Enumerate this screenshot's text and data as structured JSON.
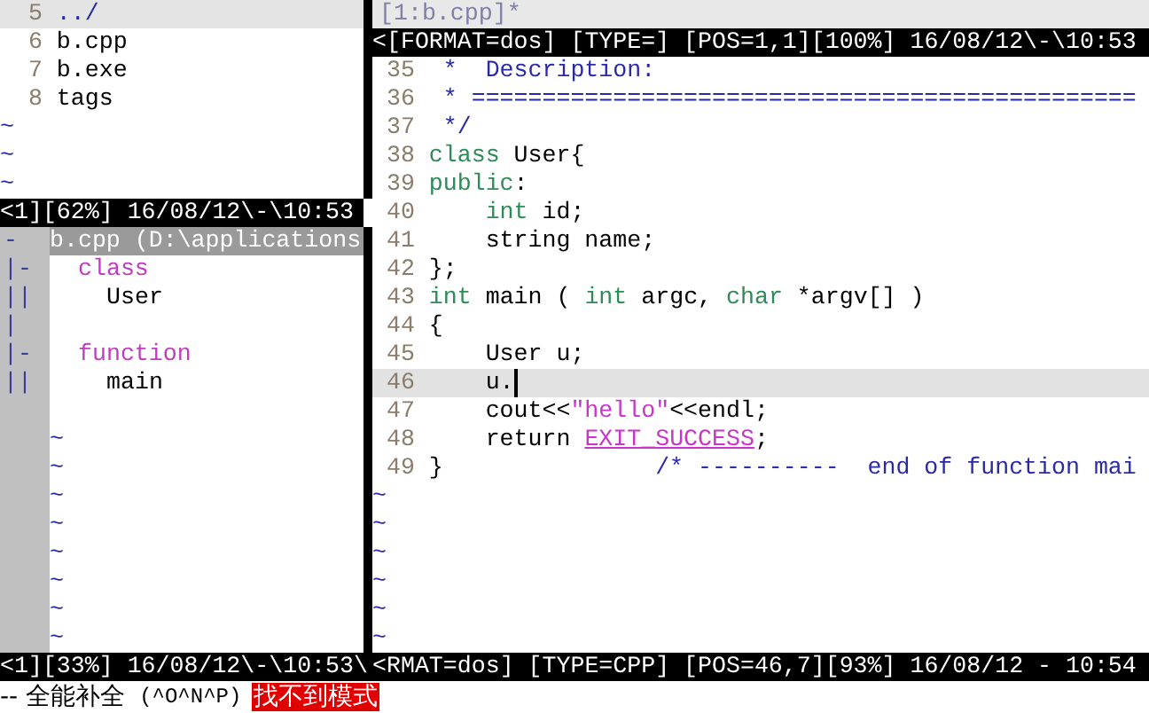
{
  "file_tree": {
    "lines": [
      {
        "number": "5",
        "name": "../",
        "selected": true
      },
      {
        "number": "6",
        "name": "b.cpp",
        "selected": false
      },
      {
        "number": "7",
        "name": "b.exe",
        "selected": false
      },
      {
        "number": "8",
        "name": "tags",
        "selected": false
      }
    ],
    "filler_lines": [
      "~",
      "~",
      "~"
    ],
    "status": "<1][62%] 16/08/12\\-\\10:53"
  },
  "taglist": {
    "header": {
      "fold": "-",
      "text": "b.cpp (D:\\applications"
    },
    "rows": [
      {
        "kind": "group",
        "fold": "|-",
        "text": "class"
      },
      {
        "kind": "tag",
        "fold": "||",
        "text": "User"
      },
      {
        "kind": "blank",
        "fold": "|"
      },
      {
        "kind": "group",
        "fold": "|-",
        "text": "function"
      },
      {
        "kind": "tag",
        "fold": "||",
        "text": "main"
      },
      {
        "kind": "blank"
      }
    ],
    "filler_lines": [
      "~",
      "~",
      "~",
      "~",
      "~",
      "~",
      "~",
      "~"
    ],
    "status": "<1][33%] 16/08/12\\-\\10:53\\"
  },
  "editor": {
    "tab": "[1:b.cpp]*",
    "top_status": "<[FORMAT=dos] [TYPE=] [POS=1,1][100%] 16/08/12\\-\\10:53",
    "lines": [
      {
        "number": "35",
        "current": false,
        "segments": [
          {
            "kind": "comment",
            "text": " *  Description:"
          }
        ]
      },
      {
        "number": "36",
        "current": false,
        "segments": [
          {
            "kind": "comment",
            "text": " * ==============================================="
          }
        ]
      },
      {
        "number": "37",
        "current": false,
        "segments": [
          {
            "kind": "comment",
            "text": " */"
          }
        ]
      },
      {
        "number": "38",
        "current": false,
        "segments": [
          {
            "kind": "keyword",
            "text": "class"
          },
          {
            "kind": "plain",
            "text": " User{"
          }
        ]
      },
      {
        "number": "39",
        "current": false,
        "segments": [
          {
            "kind": "keyword",
            "text": "public"
          },
          {
            "kind": "plain",
            "text": ":"
          }
        ]
      },
      {
        "number": "40",
        "current": false,
        "segments": [
          {
            "kind": "keyword",
            "text": "    int"
          },
          {
            "kind": "plain",
            "text": " id;"
          }
        ]
      },
      {
        "number": "41",
        "current": false,
        "segments": [
          {
            "kind": "plain",
            "text": "    string name;"
          }
        ]
      },
      {
        "number": "42",
        "current": false,
        "segments": [
          {
            "kind": "plain",
            "text": "};"
          }
        ]
      },
      {
        "number": "43",
        "current": false,
        "segments": [
          {
            "kind": "keyword",
            "text": "int"
          },
          {
            "kind": "plain",
            "text": " main ( "
          },
          {
            "kind": "keyword",
            "text": "int"
          },
          {
            "kind": "plain",
            "text": " argc, "
          },
          {
            "kind": "keyword",
            "text": "char"
          },
          {
            "kind": "plain",
            "text": " *argv[] )"
          }
        ]
      },
      {
        "number": "44",
        "current": false,
        "segments": [
          {
            "kind": "plain",
            "text": "{"
          }
        ]
      },
      {
        "number": "45",
        "current": false,
        "segments": [
          {
            "kind": "plain",
            "text": "    User u;"
          }
        ]
      },
      {
        "number": "46",
        "current": true,
        "segments": [
          {
            "kind": "plain",
            "text": "    u."
          }
        ]
      },
      {
        "number": "47",
        "current": false,
        "segments": [
          {
            "kind": "plain",
            "text": "    cout<<"
          },
          {
            "kind": "string",
            "text": "\"hello\""
          },
          {
            "kind": "plain",
            "text": "<<endl;"
          }
        ]
      },
      {
        "number": "48",
        "current": false,
        "segments": [
          {
            "kind": "plain",
            "text": "    return "
          },
          {
            "kind": "constant",
            "text": "EXIT_SUCCESS"
          },
          {
            "kind": "plain",
            "text": ";"
          }
        ]
      },
      {
        "number": "49",
        "current": false,
        "segments": [
          {
            "kind": "plain",
            "text": "}               "
          },
          {
            "kind": "comment",
            "text": "/* ----------  end of function mai"
          }
        ]
      }
    ],
    "filler_lines": [
      "~",
      "~",
      "~",
      "~",
      "~",
      "~"
    ],
    "status": "<RMAT=dos] [TYPE=CPP] [POS=46,7][93%] 16/08/12 - 10:54"
  },
  "command_line": {
    "mode": "-- 全能补全",
    "keys": "(^O^N^P)",
    "error": "找不到模式"
  }
}
